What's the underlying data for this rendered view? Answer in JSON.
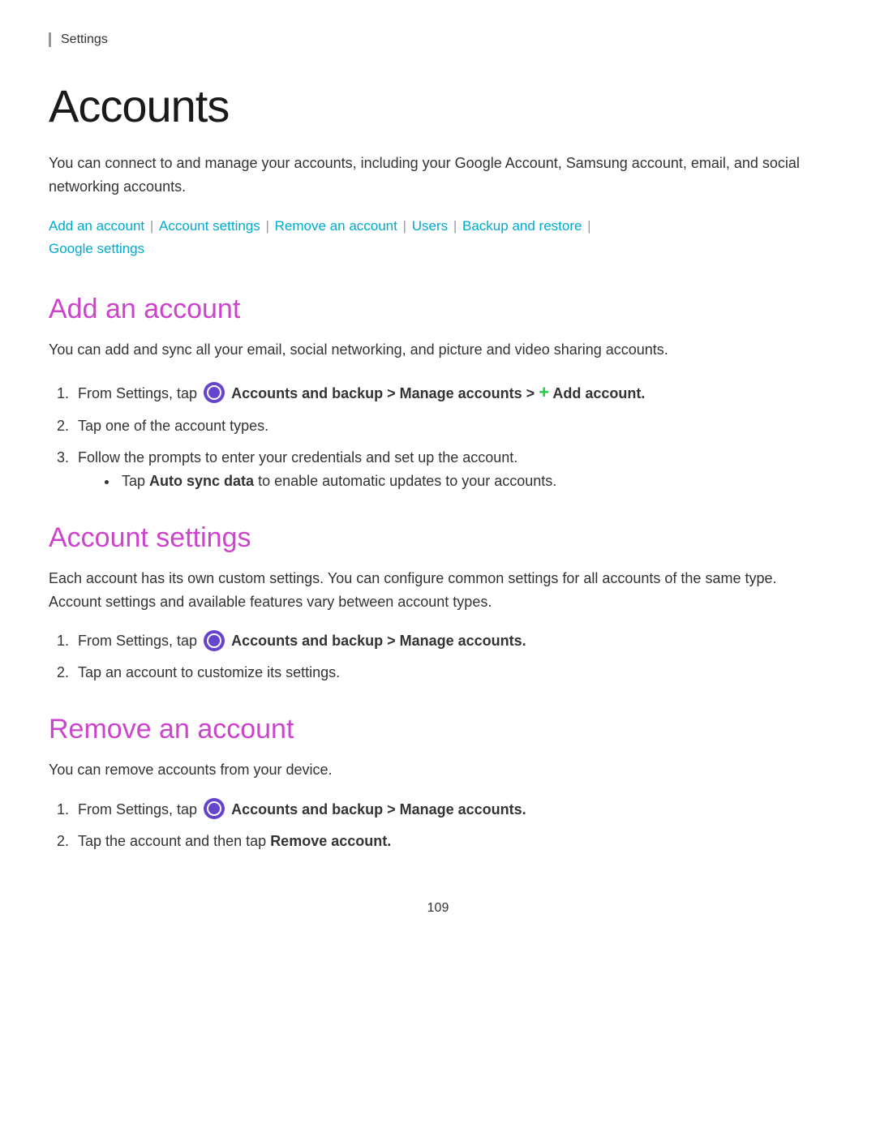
{
  "breadcrumb": "Settings",
  "page": {
    "title": "Accounts",
    "intro": "You can connect to and manage your accounts, including your Google Account, Samsung account, email, and social networking accounts.",
    "nav": {
      "links": [
        {
          "label": "Add an account",
          "id": "add-an-account"
        },
        {
          "label": "Account settings",
          "id": "account-settings"
        },
        {
          "label": "Remove an account",
          "id": "remove-an-account"
        },
        {
          "label": "Users",
          "id": "users"
        },
        {
          "label": "Backup and restore",
          "id": "backup-and-restore"
        },
        {
          "label": "Google settings",
          "id": "google-settings"
        }
      ]
    },
    "sections": [
      {
        "id": "add-an-account",
        "title": "Add an account",
        "intro": "You can add and sync all your email, social networking, and picture and video sharing accounts.",
        "steps": [
          {
            "type": "ordered",
            "text_before": "From Settings, tap ",
            "icon": "settings-icon",
            "text_bold": "Accounts and backup > Manage accounts > ",
            "plus": true,
            "text_bold2": " Add account."
          },
          {
            "type": "ordered",
            "text": "Tap one of the account types."
          },
          {
            "type": "ordered",
            "text": "Follow the prompts to enter your credentials and set up the account.",
            "bullet": "Tap Auto sync data to enable automatic updates to your accounts."
          }
        ]
      },
      {
        "id": "account-settings",
        "title": "Account settings",
        "intro": "Each account has its own custom settings. You can configure common settings for all accounts of the same type. Account settings and available features vary between account types.",
        "steps": [
          {
            "type": "ordered",
            "text_before": "From Settings, tap ",
            "icon": "settings-icon",
            "text_bold": "Accounts and backup > Manage accounts."
          },
          {
            "type": "ordered",
            "text": "Tap an account to customize its settings."
          }
        ]
      },
      {
        "id": "remove-an-account",
        "title": "Remove an account",
        "intro": "You can remove accounts from your device.",
        "steps": [
          {
            "type": "ordered",
            "text_before": "From Settings, tap ",
            "icon": "settings-icon",
            "text_bold": "Accounts and backup > Manage accounts."
          },
          {
            "type": "ordered",
            "text_before": "Tap the account and then tap ",
            "text_bold": "Remove account."
          }
        ]
      }
    ]
  },
  "page_number": "109"
}
